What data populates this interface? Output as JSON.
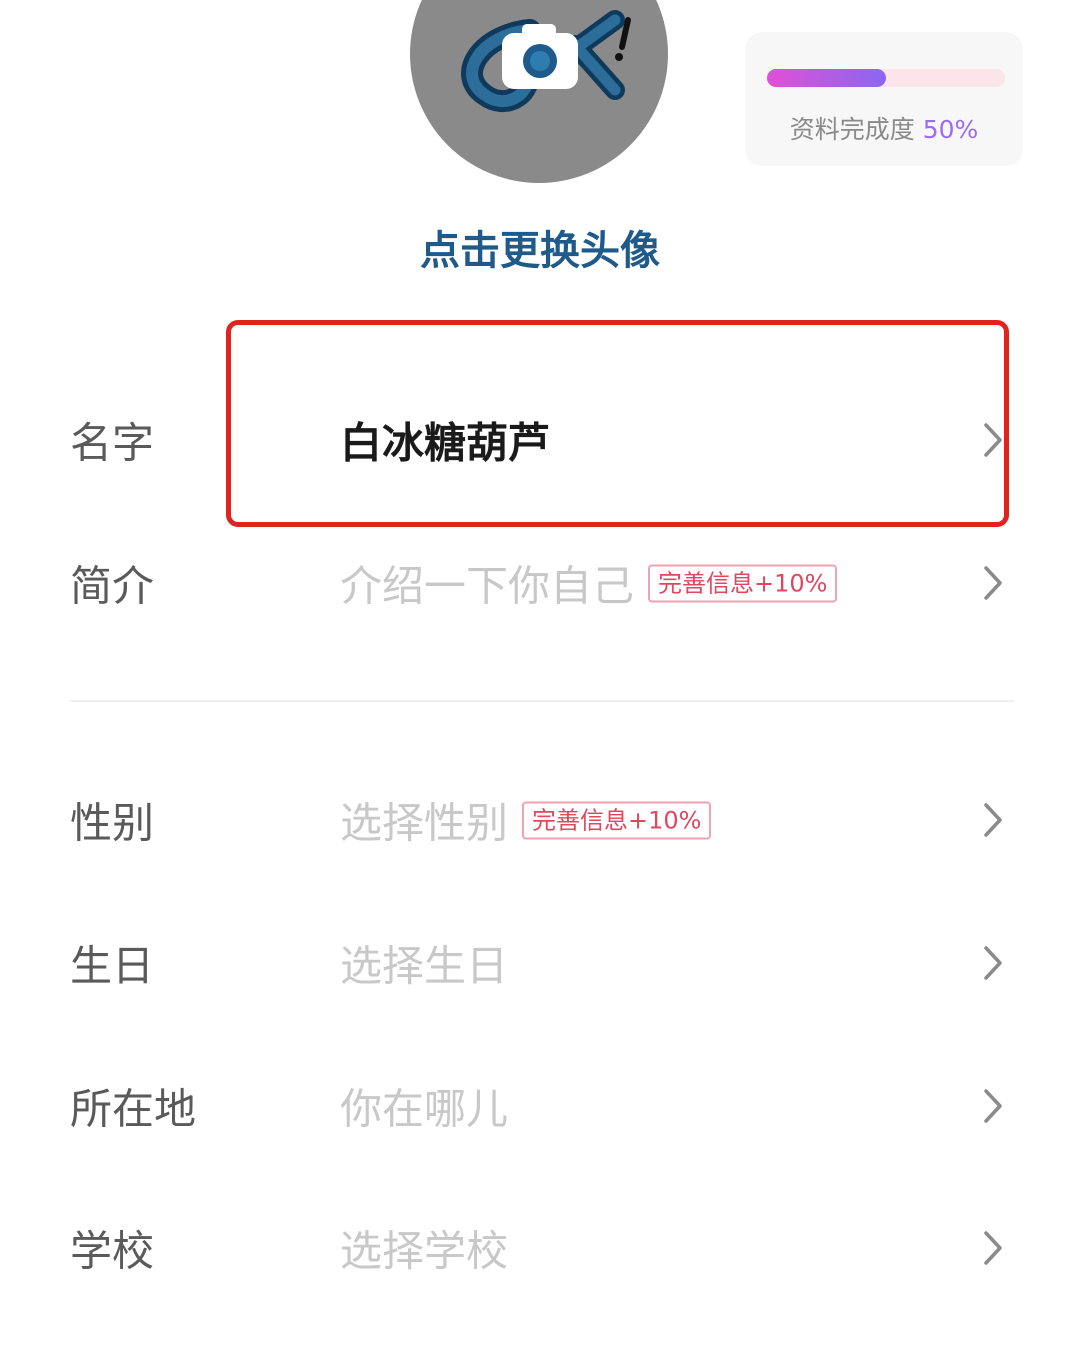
{
  "avatar": {
    "change_label": "点击更换头像",
    "icon": "camera-icon"
  },
  "completion": {
    "label": "资料完成度",
    "percent_text": "50%",
    "fraction": 0.5
  },
  "rows": [
    {
      "label": "名字",
      "value": "白冰糖葫芦"
    },
    {
      "label": "简介",
      "value": "介绍一下你自己",
      "badge": "完善信息+10%"
    },
    {
      "label": "性别",
      "value": "选择性别",
      "badge": "完善信息+10%"
    },
    {
      "label": "生日",
      "value": "选择生日"
    },
    {
      "label": "所在地",
      "value": "你在哪儿"
    },
    {
      "label": "学校",
      "value": "选择学校"
    }
  ],
  "colors": {
    "accent_blue": "#1e5a8a",
    "highlight_red": "#e0231f",
    "badge_red": "#e0475f",
    "progress_start": "#e24fd6",
    "progress_end": "#8a67f2"
  }
}
